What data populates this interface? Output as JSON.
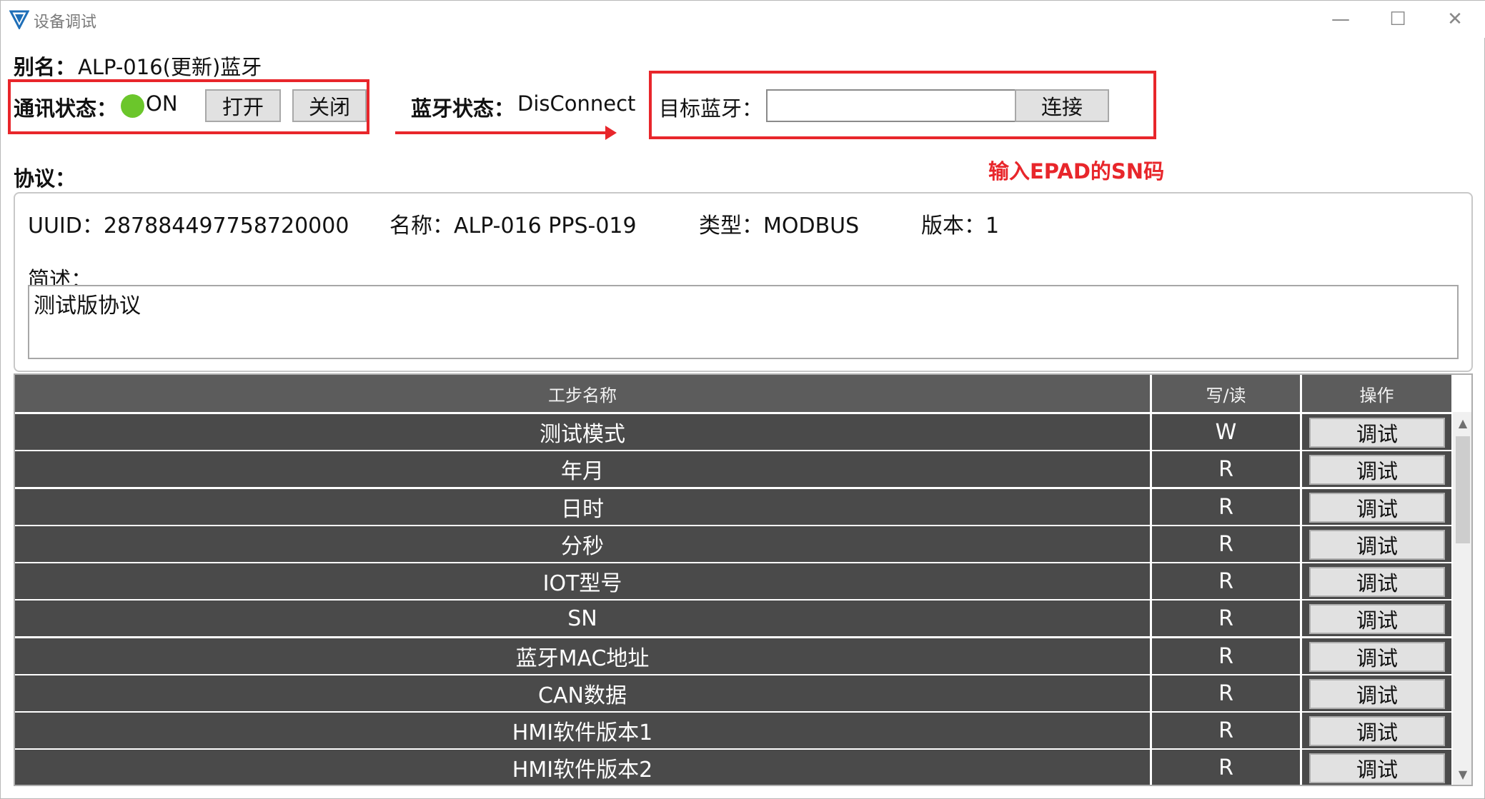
{
  "window": {
    "title": "设备调试",
    "minimize_glyph": "—",
    "maximize_glyph": "☐",
    "close_glyph": "✕"
  },
  "alias": {
    "label": "别名：",
    "value": "ALP-016(更新)蓝牙"
  },
  "comm": {
    "label": "通讯状态：",
    "value": "ON",
    "indicator_color": "#6bc62b",
    "open_label": "打开",
    "close_label": "关闭"
  },
  "bluetooth": {
    "label": "蓝牙状态：",
    "value": "DisConnect"
  },
  "target": {
    "label": "目标蓝牙：",
    "input_value": "",
    "input_placeholder": "",
    "connect_label": "连接"
  },
  "annotation": {
    "text": "输入EPAD的SN码",
    "color": "#e8262b"
  },
  "protocol": {
    "label": "协议：",
    "uuid": "UUID：287884497758720000",
    "name": "名称：ALP-016  PPS-019",
    "type": "类型：MODBUS",
    "version": "版本：1",
    "description_label": "简述：",
    "description": "测试版协议"
  },
  "table": {
    "headers": {
      "name": "工步名称",
      "rw": "写/读",
      "op": "操作"
    },
    "rows": [
      {
        "name": "测试模式",
        "rw": "W",
        "op": "调试"
      },
      {
        "name": "年月",
        "rw": "R",
        "op": "调试"
      },
      {
        "name": "日时",
        "rw": "R",
        "op": "调试"
      },
      {
        "name": "分秒",
        "rw": "R",
        "op": "调试"
      },
      {
        "name": "IOT型号",
        "rw": "R",
        "op": "调试"
      },
      {
        "name": "SN",
        "rw": "R",
        "op": "调试"
      },
      {
        "name": "蓝牙MAC地址",
        "rw": "R",
        "op": "调试"
      },
      {
        "name": "CAN数据",
        "rw": "R",
        "op": "调试"
      },
      {
        "name": "HMI软件版本1",
        "rw": "R",
        "op": "调试"
      },
      {
        "name": "HMI软件版本2",
        "rw": "R",
        "op": "调试"
      }
    ]
  },
  "scrollbar": {
    "up_glyph": "▲",
    "down_glyph": "▼"
  }
}
